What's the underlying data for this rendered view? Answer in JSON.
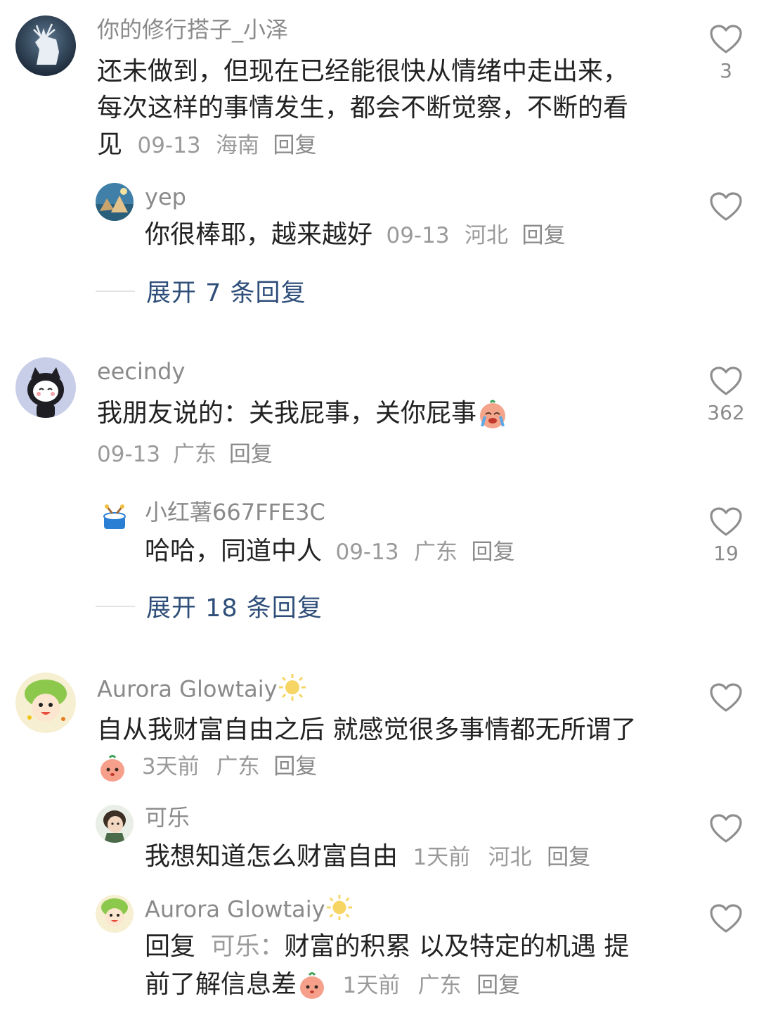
{
  "comments": [
    {
      "author": "你的修行搭子_小泽",
      "text_line1": "还未做到，但现在已经能很快从情绪中走出来，",
      "text_line2": "每次这样的事情发生，都会不断觉察，不断的看",
      "text_line3": "见",
      "date": "09-13",
      "location": "海南",
      "reply_label": "回复",
      "likes": "3",
      "avatar_icon": "white-deer-avatar",
      "replies": [
        {
          "author": "yep",
          "text": "你很棒耶，越来越好",
          "date": "09-13",
          "location": "河北",
          "reply_label": "回复",
          "likes": "",
          "avatar_icon": "landscape-avatar"
        }
      ],
      "expand_label": "展开 7 条回复"
    },
    {
      "author": "eecindy",
      "text": "我朋友说的：关我屁事，关你屁事",
      "text_emoji": "crying-face-emoji",
      "date": "09-13",
      "location": "广东",
      "reply_label": "回复",
      "likes": "362",
      "avatar_icon": "cartoon-girl-avatar",
      "replies": [
        {
          "author": "小红薯667FFE3C",
          "text": "哈哈，同道中人",
          "date": "09-13",
          "location": "广东",
          "reply_label": "回复",
          "likes": "19",
          "avatar_icon": "drum-avatar"
        }
      ],
      "expand_label": "展开 18 条回复"
    },
    {
      "author": "Aurora Glowtaiy",
      "author_badge": "sun-emoji",
      "text": "自从我财富自由之后 就感觉很多事情都无所谓了",
      "text_emoji": "peach-face-emoji",
      "date": "3天前",
      "location": "广东",
      "reply_label": "回复",
      "likes": "",
      "avatar_icon": "green-hair-kid-avatar",
      "replies": [
        {
          "author": "可乐",
          "text": "我想知道怎么财富自由",
          "date": "1天前",
          "location": "河北",
          "reply_label": "回复",
          "likes": "",
          "avatar_icon": "girl-portrait-avatar"
        },
        {
          "author": "Aurora Glowtaiy",
          "author_badge": "sun-emoji",
          "reply_prefix": "回复",
          "reply_to": "可乐：",
          "text_line1": "财富的积累 以及特定的机遇 提",
          "text_line2": "前了解信息差",
          "text_emoji": "peach-face-emoji",
          "date": "1天前",
          "location": "广东",
          "reply_label": "回复",
          "likes": "",
          "avatar_icon": "green-hair-kid-avatar"
        }
      ]
    }
  ],
  "colors": {
    "expand_link": "#2f4f7a",
    "meta_gray": "#9a9a9a",
    "name_gray": "#8a8a8a",
    "text": "#222222"
  }
}
